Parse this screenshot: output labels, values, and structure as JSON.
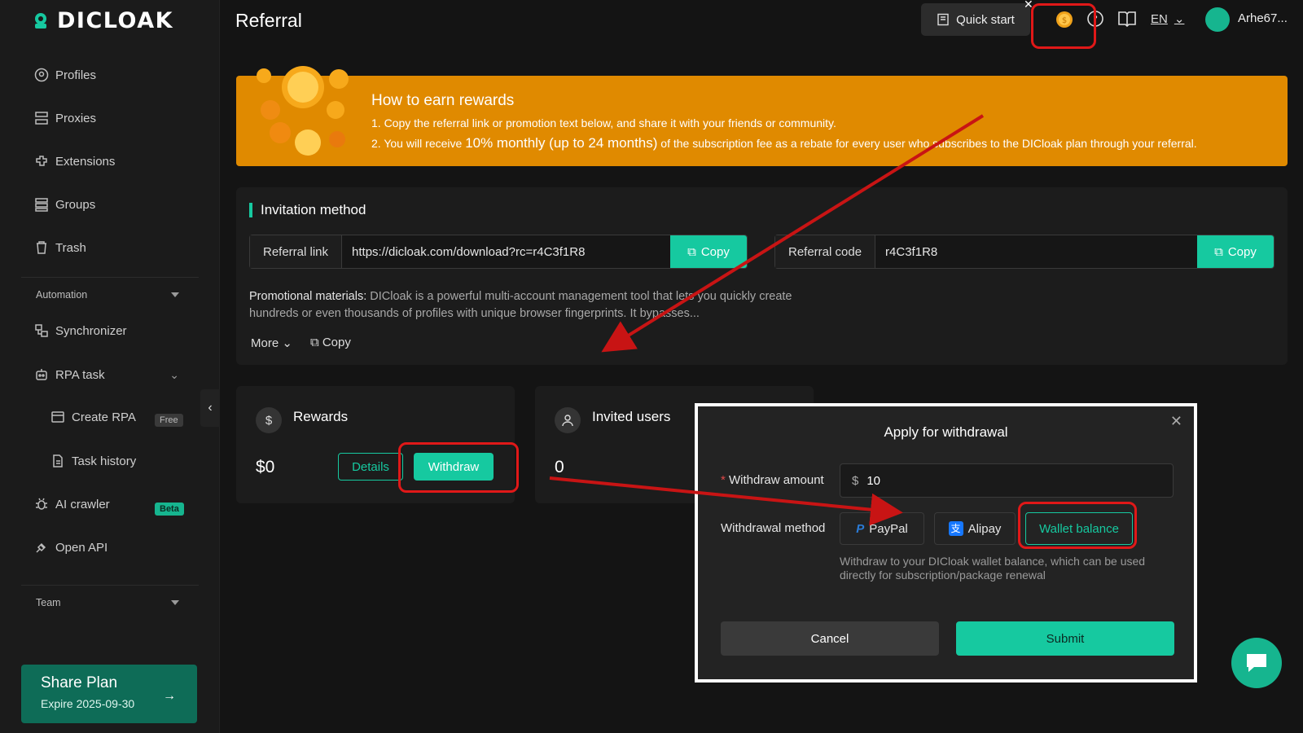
{
  "brand": {
    "name": "DICLOAK",
    "accent": "#16c9a0",
    "banner_color": "#e08a00"
  },
  "sidebar": {
    "items": [
      {
        "label": "Profiles"
      },
      {
        "label": "Proxies"
      },
      {
        "label": "Extensions"
      },
      {
        "label": "Groups"
      },
      {
        "label": "Trash"
      }
    ],
    "automation_label": "Automation",
    "automation_items": [
      {
        "label": "Synchronizer"
      },
      {
        "label": "RPA task"
      },
      {
        "label": "Create RPA",
        "badge": "Free"
      },
      {
        "label": "Task history"
      },
      {
        "label": "AI crawler",
        "badge": "Beta"
      },
      {
        "label": "Open API"
      }
    ],
    "team_label": "Team",
    "share_plan": {
      "title": "Share Plan",
      "expire": "Expire 2025-09-30"
    }
  },
  "header": {
    "title": "Referral",
    "quick_start": "Quick start",
    "lang": "EN",
    "username": "Arhe67..."
  },
  "banner": {
    "title": "How to earn rewards",
    "line1": "1. Copy the referral link or promotion text below, and share it with your friends or community.",
    "line2_prefix": "2. You will receive ",
    "line2_highlight": "10% monthly (up to 24 months)",
    "line2_suffix": " of the subscription fee as a rebate for every user who subscribes to the DICloak plan through your referral."
  },
  "invitation": {
    "title": "Invitation method",
    "referral_link_label": "Referral link",
    "referral_link_value": "https://dicloak.com/download?rc=r4C3f1R8",
    "referral_code_label": "Referral code",
    "referral_code_value": "r4C3f1R8",
    "copy_label": "Copy",
    "promo_label": "Promotional materials:",
    "promo_text": "DICloak is a powerful multi-account management tool that lets you quickly create hundreds or even thousands of profiles with unique browser fingerprints. It bypasses...",
    "more_label": "More",
    "promo_copy_label": "Copy"
  },
  "rewards": {
    "title": "Rewards",
    "icon": "$",
    "value": "$0",
    "details_label": "Details",
    "withdraw_label": "Withdraw"
  },
  "invited": {
    "title": "Invited users",
    "value": "0"
  },
  "modal": {
    "title": "Apply for withdrawal",
    "amount_label": "Withdraw amount",
    "amount_currency": "$",
    "amount_value": "10",
    "method_label": "Withdrawal method",
    "methods": [
      "PayPal",
      "Alipay",
      "Wallet balance"
    ],
    "selected_method": "Wallet balance",
    "hint": "Withdraw to your DICloak wallet balance, which can be used directly for subscription/package renewal",
    "cancel_label": "Cancel",
    "submit_label": "Submit"
  }
}
